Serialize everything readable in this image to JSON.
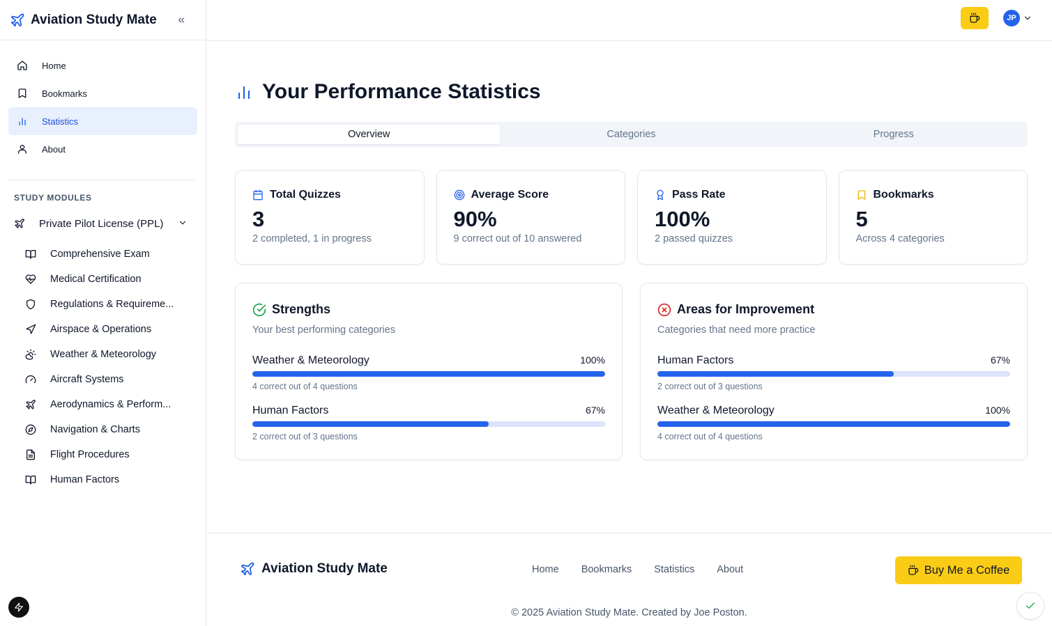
{
  "app": {
    "name": "Aviation Study Mate"
  },
  "colors": {
    "accent": "#2563eb",
    "coffee": "#facc15",
    "strength": "#16a34a",
    "improve": "#dc2626",
    "bookmark": "#eab308"
  },
  "sidebar": {
    "nav": [
      {
        "label": "Home",
        "icon": "home-icon"
      },
      {
        "label": "Bookmarks",
        "icon": "bookmark-icon"
      },
      {
        "label": "Statistics",
        "icon": "bar-chart-icon",
        "active": true
      },
      {
        "label": "About",
        "icon": "user-icon"
      }
    ],
    "section_label": "STUDY MODULES",
    "module": {
      "label": "Private Pilot License (PPL)",
      "icon": "plane-icon"
    },
    "sub_items": [
      {
        "label": "Comprehensive Exam",
        "icon": "book-open-icon"
      },
      {
        "label": "Medical Certification",
        "icon": "heart-pulse-icon"
      },
      {
        "label": "Regulations & Requireme...",
        "icon": "shield-icon"
      },
      {
        "label": "Airspace & Operations",
        "icon": "navigation-icon"
      },
      {
        "label": "Weather & Meteorology",
        "icon": "cloud-sun-icon"
      },
      {
        "label": "Aircraft Systems",
        "icon": "gauge-icon"
      },
      {
        "label": "Aerodynamics & Perform...",
        "icon": "plane-icon"
      },
      {
        "label": "Navigation & Charts",
        "icon": "compass-icon"
      },
      {
        "label": "Flight Procedures",
        "icon": "file-text-icon"
      },
      {
        "label": "Human Factors",
        "icon": "book-open-icon"
      }
    ]
  },
  "topbar": {
    "avatar_initials": "JP"
  },
  "page": {
    "title": "Your Performance Statistics",
    "tabs": [
      "Overview",
      "Categories",
      "Progress"
    ],
    "active_tab": "Overview"
  },
  "stats": [
    {
      "title": "Total Quizzes",
      "value": "3",
      "sub": "2 completed, 1 in progress",
      "icon": "calendar-icon"
    },
    {
      "title": "Average Score",
      "value": "90%",
      "sub": "9 correct out of 10 answered",
      "icon": "target-icon"
    },
    {
      "title": "Pass Rate",
      "value": "100%",
      "sub": "2 passed quizzes",
      "icon": "award-icon"
    },
    {
      "title": "Bookmarks",
      "value": "5",
      "sub": "Across 4 categories",
      "icon": "bookmark-icon"
    }
  ],
  "strengths": {
    "title": "Strengths",
    "desc": "Your best performing categories",
    "items": [
      {
        "name": "Weather & Meteorology",
        "pct": "100%",
        "fraction": 1.0,
        "note": "4 correct out of 4 questions"
      },
      {
        "name": "Human Factors",
        "pct": "67%",
        "fraction": 0.67,
        "note": "2 correct out of 3 questions"
      }
    ]
  },
  "improvement": {
    "title": "Areas for Improvement",
    "desc": "Categories that need more practice",
    "items": [
      {
        "name": "Human Factors",
        "pct": "67%",
        "fraction": 0.67,
        "note": "2 correct out of 3 questions"
      },
      {
        "name": "Weather & Meteorology",
        "pct": "100%",
        "fraction": 1.0,
        "note": "4 correct out of 4 questions"
      }
    ]
  },
  "footer": {
    "brand": "Aviation Study Mate",
    "links": [
      "Home",
      "Bookmarks",
      "Statistics",
      "About"
    ],
    "coffee_label": "Buy Me a Coffee",
    "copyright": "© 2025 Aviation Study Mate. Created by Joe Poston."
  }
}
